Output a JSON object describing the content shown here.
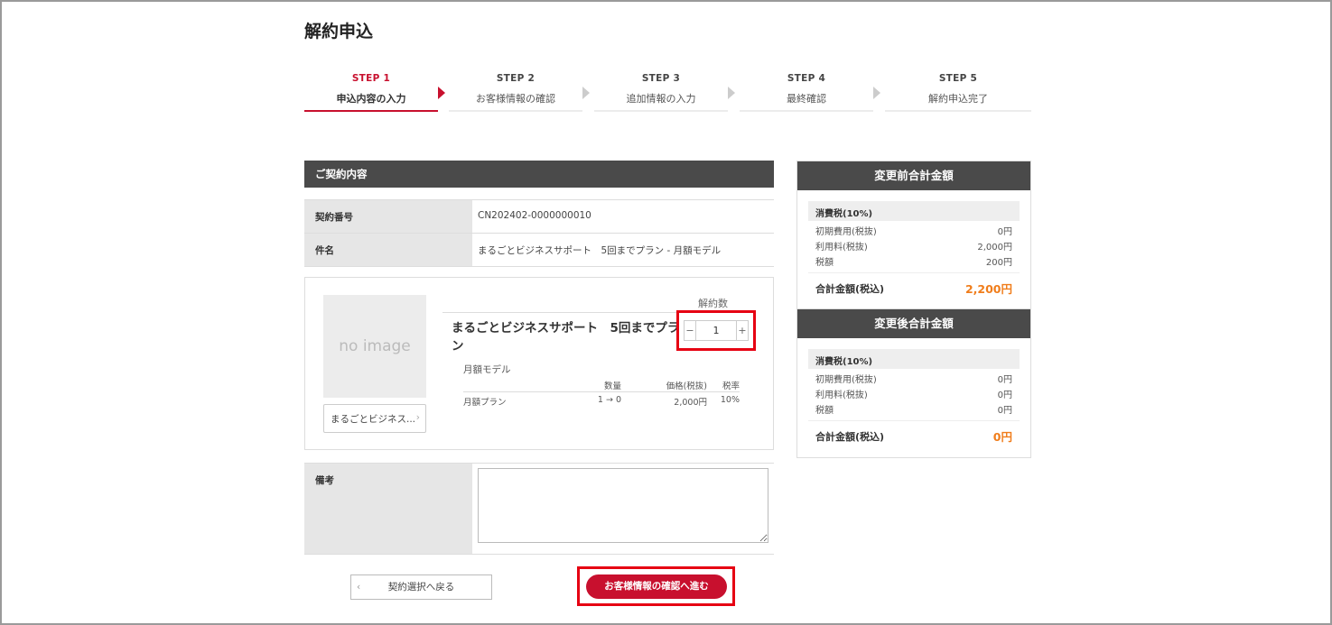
{
  "page": {
    "title": "解約申込"
  },
  "steps": [
    {
      "num": "STEP 1",
      "label": "申込内容の入力"
    },
    {
      "num": "STEP 2",
      "label": "お客様情報の確認"
    },
    {
      "num": "STEP 3",
      "label": "追加情報の入力"
    },
    {
      "num": "STEP 4",
      "label": "最終確認"
    },
    {
      "num": "STEP 5",
      "label": "解約申込完了"
    }
  ],
  "contract": {
    "section_title": "ご契約内容",
    "rows": [
      {
        "label": "契約番号",
        "value": "CN202402-0000000010"
      },
      {
        "label": "件名",
        "value": "まるごとビジネスサポート　5回までプラン - 月額モデル"
      }
    ]
  },
  "product": {
    "image_placeholder": "no image",
    "link_label": "まるごとビジネス...",
    "link_chevron": "›",
    "qty_label": "解約数",
    "name": "まるごとビジネスサポート　5回までプラン",
    "quantity": "1",
    "minus": "−",
    "plus": "+",
    "model": "月額モデル",
    "columns": [
      "数量",
      "価格(税抜)",
      "税率"
    ],
    "lines": [
      {
        "name": "月額プラン",
        "qty": "1 → 0",
        "price": "2,000円",
        "tax": "10%"
      }
    ]
  },
  "remark": {
    "label": "備考",
    "value": ""
  },
  "buttons": {
    "back": "契約選択へ戻る",
    "back_chevron": "‹",
    "next": "お客様情報の確認へ進む"
  },
  "before": {
    "title": "変更前合計金額",
    "tax_label": "消費税(10%)",
    "lines": [
      {
        "label": "初期費用(税抜)",
        "value": "0円"
      },
      {
        "label": "利用料(税抜)",
        "value": "2,000円"
      },
      {
        "label": "税額",
        "value": "200円"
      }
    ],
    "total_label": "合計金額(税込)",
    "total_value": "2,200円"
  },
  "after": {
    "title": "変更後合計金額",
    "tax_label": "消費税(10%)",
    "lines": [
      {
        "label": "初期費用(税抜)",
        "value": "0円"
      },
      {
        "label": "利用料(税抜)",
        "value": "0円"
      },
      {
        "label": "税額",
        "value": "0円"
      }
    ],
    "total_label": "合計金額(税込)",
    "total_value": "0円"
  },
  "colors": {
    "accent": "#c8102e",
    "highlight": "#e60012",
    "price": "#f07d1b",
    "header_bg": "#4a4a4a"
  }
}
